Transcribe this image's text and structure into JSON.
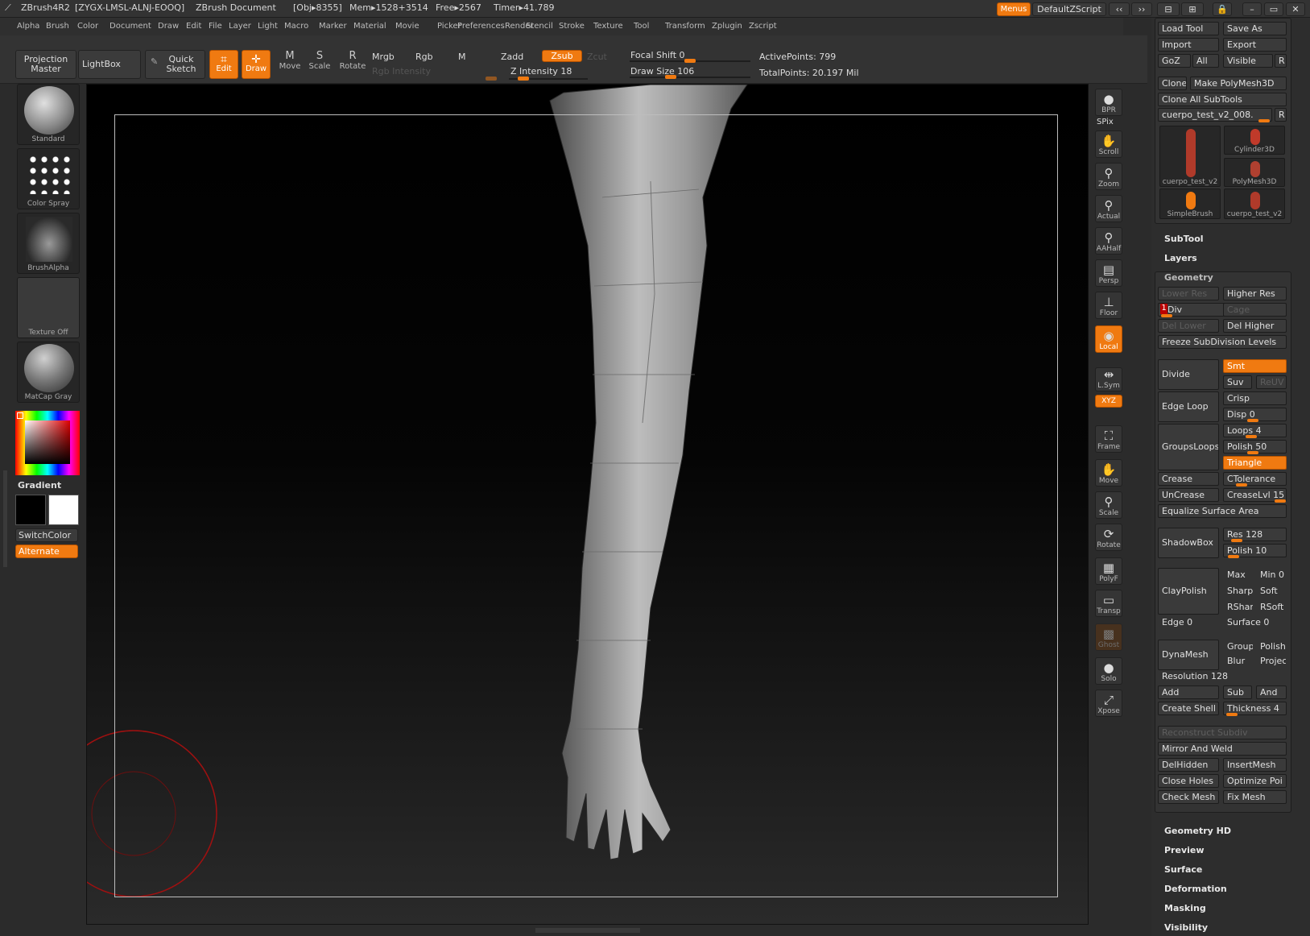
{
  "titlebar": {
    "app": "ZBrush4R2",
    "code": "[ZYGX-LMSL-ALNJ-EOOQ]",
    "document": "ZBrush Document",
    "obj": "[Obj▸8355]",
    "mem": "Mem▸1528+3514",
    "free": "Free▸2567",
    "timer": "Timer▸41.789",
    "menus": "Menus",
    "script": "DefaultZScript"
  },
  "menubar": [
    "Alpha",
    "Brush",
    "Color",
    "Document",
    "Draw",
    "Edit",
    "File",
    "Layer",
    "Light",
    "Macro",
    "Marker",
    "Material",
    "Movie",
    "Picker",
    "Preferences",
    "Render",
    "Stencil",
    "Stroke",
    "Texture",
    "Tool",
    "Transform",
    "Zplugin",
    "Zscript"
  ],
  "shelf": {
    "projection": "Projection Master",
    "lightbox": "LightBox",
    "quick_sketch": "Quick Sketch",
    "edit": "Edit",
    "draw": "Draw",
    "move": "Move",
    "scale": "Scale",
    "rotate": "Rotate",
    "mrgb": "Mrgb",
    "rgb": "Rgb",
    "m": "M",
    "zadd": "Zadd",
    "zsub": "Zsub",
    "zcut": "Zcut",
    "rgb_intensity": "Rgb Intensity",
    "z_intensity": "Z Intensity 18",
    "focal_shift": "Focal Shift 0",
    "draw_size": "Draw Size 106",
    "active_points": "ActivePoints: 799",
    "total_points": "TotalPoints: 20.197 Mil",
    "z_intensity_value": 18,
    "focal_shift_value": 0,
    "draw_size_value": 106
  },
  "left": {
    "standard": "Standard",
    "color_spray": "Color Spray",
    "brush_alpha": "BrushAlpha",
    "texture_off": "Texture Off",
    "matcap": "MatCap Gray",
    "gradient": "Gradient",
    "switch_color": "SwitchColor",
    "alternate": "Alternate",
    "main_color": "#000000",
    "secondary_color": "#ffffff"
  },
  "right": [
    {
      "n": "bpr",
      "l": "BPR"
    },
    {
      "n": "spix",
      "l": "SPix"
    },
    {
      "n": "scroll",
      "l": "Scroll"
    },
    {
      "n": "zoom",
      "l": "Zoom"
    },
    {
      "n": "actual",
      "l": "Actual"
    },
    {
      "n": "aahalf",
      "l": "AAHalf"
    },
    {
      "n": "persp",
      "l": "Persp"
    },
    {
      "n": "floor",
      "l": "Floor"
    },
    {
      "n": "local",
      "l": "Local"
    },
    {
      "n": "lsym",
      "l": "L.Sym"
    },
    {
      "n": "xyz",
      "l": "XYZ"
    },
    {
      "n": "frame",
      "l": "Frame"
    },
    {
      "n": "move",
      "l": "Move"
    },
    {
      "n": "scale",
      "l": "Scale"
    },
    {
      "n": "rotate",
      "l": "Rotate"
    },
    {
      "n": "polyf",
      "l": "PolyF"
    },
    {
      "n": "transp",
      "l": "Transp"
    },
    {
      "n": "ghost",
      "l": "Ghost"
    },
    {
      "n": "solo",
      "l": "Solo"
    },
    {
      "n": "xpose",
      "l": "Xpose"
    }
  ],
  "tool": {
    "load": "Load Tool",
    "save_as": "Save As",
    "import": "Import",
    "export": "Export",
    "goz": "GoZ",
    "all": "All",
    "visible": "Visible",
    "r": "R",
    "clone": "Clone",
    "make_polymesh": "Make PolyMesh3D",
    "clone_all": "Clone All SubTools",
    "current": "cuerpo_test_v2_008.",
    "thumb1": "cuerpo_test_v2",
    "cyl": "Cylinder3D",
    "poly": "PolyMesh3D",
    "simple": "SimpleBrush",
    "thumb2": "cuerpo_test_v2"
  },
  "panels": {
    "subtool": "SubTool",
    "layers": "Layers",
    "geometry": "Geometry",
    "geometry_hd": "Geometry HD",
    "preview": "Preview",
    "surface": "Surface",
    "deformation": "Deformation",
    "masking": "Masking",
    "visibility": "Visibility"
  },
  "geometry": {
    "lower_res": "Lower Res",
    "higher_res": "Higher Res",
    "sdiv": "SDiv",
    "sdiv_val": "1",
    "cage": "Cage",
    "del_lower": "Del Lower",
    "del_higher": "Del Higher",
    "freeze": "Freeze SubDivision Levels",
    "divide": "Divide",
    "smt": "Smt",
    "suv": "Suv",
    "reuv": "ReUV",
    "edge_loop": "Edge Loop",
    "crisp": "Crisp",
    "disp": "Disp 0",
    "groups_loops": "GroupsLoops",
    "loops": "Loops 4",
    "polish": "Polish 50",
    "triangle": "Triangle",
    "crease": "Crease",
    "ctolerance": "CTolerance",
    "uncrease": "UnCrease",
    "creaselvl": "CreaseLvl 15",
    "equalize": "Equalize Surface Area",
    "shadowbox": "ShadowBox",
    "res": "Res 128",
    "polish2": "Polish 10",
    "claypolish": "ClayPolish",
    "max": "Max",
    "min": "Min 0",
    "sharp": "Sharp",
    "soft": "Soft",
    "rshar": "RShar",
    "rsoft": "RSoft",
    "edge": "Edge 0",
    "surface": "Surface 0",
    "dynamesh": "DynaMesh",
    "group": "Group",
    "polish3": "Polish",
    "blur": "Blur",
    "project": "Projec",
    "resolution": "Resolution 128",
    "add": "Add",
    "sub": "Sub",
    "and": "And",
    "create_shell": "Create Shell",
    "thickness": "Thickness 4",
    "reconstruct": "Reconstruct Subdiv",
    "mirror": "Mirror And Weld",
    "delhidden": "DelHidden",
    "insertmesh": "InsertMesh",
    "close_holes": "Close Holes",
    "optimize": "Optimize Poi",
    "check_mesh": "Check Mesh",
    "fix_mesh": "Fix Mesh"
  },
  "colors": {
    "accent": "#f07a11",
    "background": "#2b2b2b"
  }
}
